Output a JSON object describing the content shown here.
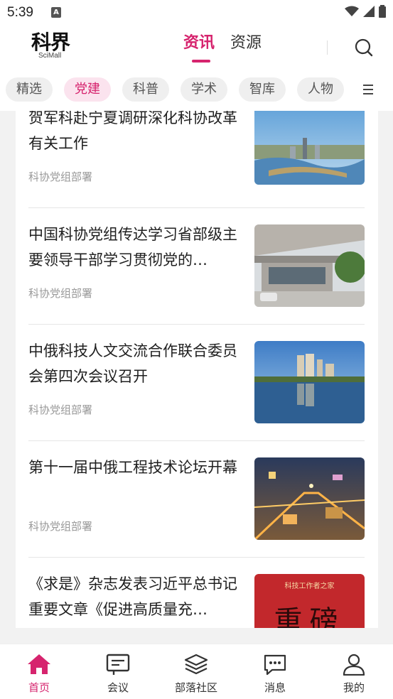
{
  "status_bar": {
    "time": "5:39",
    "notification_glyph": "A"
  },
  "header": {
    "logo_main": "科界",
    "logo_sub": "SciMall",
    "tabs": [
      {
        "label": "资讯",
        "active": true
      },
      {
        "label": "资源",
        "active": false
      }
    ],
    "search_icon": "search-icon"
  },
  "categories": [
    {
      "label": "精选",
      "active": false
    },
    {
      "label": "党建",
      "active": true
    },
    {
      "label": "科普",
      "active": false
    },
    {
      "label": "学术",
      "active": false
    },
    {
      "label": "智库",
      "active": false
    },
    {
      "label": "人物",
      "active": false
    }
  ],
  "news": [
    {
      "title": "贺军科赴宁夏调研深化科协改革有关工作",
      "source": "科协党组部署"
    },
    {
      "title": "中国科协党组传达学习省部级主要领导干部学习贯彻党的…",
      "source": "科协党组部署"
    },
    {
      "title": "中俄科技人文交流合作联合委员会第四次会议召开",
      "source": "科协党组部署"
    },
    {
      "title": "第十一届中俄工程技术论坛开幕",
      "source": "科协党组部署"
    },
    {
      "title": "《求是》杂志发表习近平总书记重要文章《促进高质量充…",
      "source": "",
      "thumb_caption": "科技工作者之家",
      "thumb_text": "重磅"
    }
  ],
  "bottom_nav": [
    {
      "label": "首页",
      "icon": "home-icon",
      "active": true
    },
    {
      "label": "会议",
      "icon": "meeting-icon",
      "active": false
    },
    {
      "label": "部落社区",
      "icon": "layers-icon",
      "active": false
    },
    {
      "label": "消息",
      "icon": "message-icon",
      "active": false
    },
    {
      "label": "我的",
      "icon": "profile-icon",
      "active": false
    }
  ],
  "colors": {
    "accent": "#d6246e",
    "chip_bg": "#efefef",
    "chip_active_bg": "#fbe3ee"
  }
}
